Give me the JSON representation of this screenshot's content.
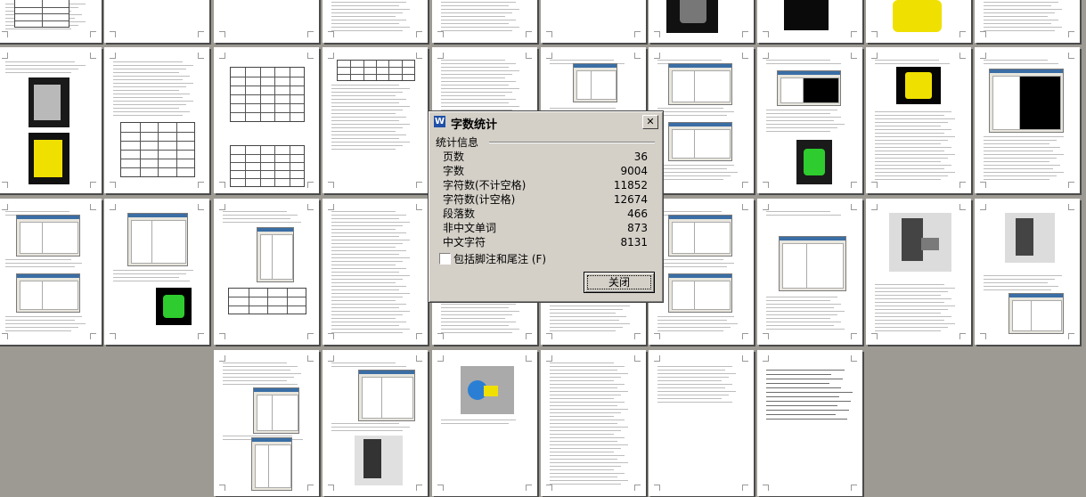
{
  "dialog": {
    "title": "字数统计",
    "app_icon_letter": "W",
    "close_symbol": "✕",
    "group_label": "统计信息",
    "stats": [
      {
        "label": "页数",
        "value": "36"
      },
      {
        "label": "字数",
        "value": "9004"
      },
      {
        "label": "字符数(不计空格)",
        "value": "11852"
      },
      {
        "label": "字符数(计空格)",
        "value": "12674"
      },
      {
        "label": "段落数",
        "value": "466"
      },
      {
        "label": "非中文单词",
        "value": "873"
      },
      {
        "label": "中文字符",
        "value": "8131"
      }
    ],
    "checkbox_label": "包括脚注和尾注 (F)",
    "checkbox_checked": false,
    "close_button_label": "关闭"
  },
  "document": {
    "page_count_visible": 36
  },
  "colors": {
    "workspace": "#9c9a92",
    "dialog_face": "#d4d0c8",
    "yellow_part": "#f0e000",
    "green_part": "#2ecc2e"
  }
}
